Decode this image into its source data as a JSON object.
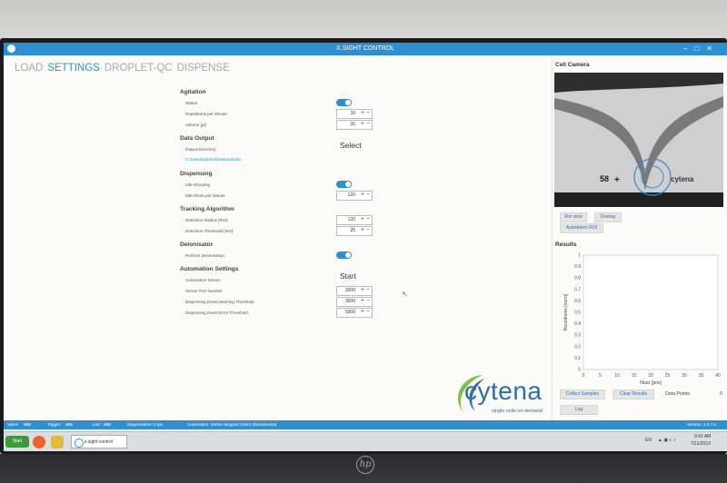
{
  "window": {
    "title": "X.SIGHT CONTROL"
  },
  "nav": {
    "tabs": [
      "LOAD",
      "SETTINGS",
      "DROPLET-QC",
      "DISPENSE"
    ],
    "active": "SETTINGS"
  },
  "agitation": {
    "title": "Agitation",
    "status_label": "Status",
    "repetitions_label": "Repetitions per Minute",
    "repetitions_value": "10",
    "volume_label": "Volume [µl]",
    "volume_value": "30"
  },
  "data_output": {
    "title": "Data Output",
    "directory_label": "Output Directory:",
    "select_label": "Select",
    "path": "C:\\Users\\admin\\Desktop\\Data"
  },
  "dispensing": {
    "title": "Dispensing",
    "idle_shooting_label": "Idle-Shooting",
    "idle_shots_label": "Idle-Shots per Minute",
    "idle_shots_value": "120"
  },
  "tracking": {
    "title": "Tracking Algorithm",
    "radius_label": "Detection Radius [RoI]:",
    "radius_value": "130",
    "threshold_label": "Detection Threshold [RoI]:",
    "threshold_value": "25"
  },
  "deionisator": {
    "title": "Deionisator",
    "perform_label": "Perform Deionisation"
  },
  "automation": {
    "title": "Automation Settings",
    "server_label": "Automation Server:",
    "start_label": "Start",
    "port_label": "Server Port Number",
    "port_value": "3000",
    "warning_label": "Dispensing Event Warning Threshold",
    "warning_value": "3000",
    "error_label": "Dispensing Event Error Threshold",
    "error_value": "5000"
  },
  "right_panel": {
    "camera_title": "Cell Camera",
    "camera_overlay_text": "cytena",
    "camera_number": "58",
    "roi_view": "RoI view",
    "overlay": "Overlay",
    "autodetect": "Autodetect ROI",
    "results_title": "Results",
    "collect_samples": "Collect Samples",
    "clear_results": "Clear Results",
    "data_points_label": "Data Points",
    "data_points_value": "0",
    "log": "Log"
  },
  "chart_data": {
    "type": "scatter",
    "xlabel": "Nozz [pos]",
    "ylabel": "Roundness [norm]",
    "xlim": [
      0,
      40
    ],
    "ylim": [
      0,
      1
    ],
    "x_ticks": [
      "0",
      "5",
      "10",
      "15",
      "20",
      "25",
      "30",
      "35",
      "40"
    ],
    "y_ticks": [
      "0",
      "0.1",
      "0.2",
      "0.3",
      "0.4",
      "0.5",
      "0.6",
      "0.7",
      "0.8",
      "0.9",
      "1"
    ],
    "series": []
  },
  "logo": {
    "word": "cytena",
    "tagline": "single cells on demand"
  },
  "statusbar": {
    "valve": "Valve:",
    "trigger": "Trigger:",
    "led": "Led:",
    "dispensation": "Dispensation: 0 ips",
    "automation": "Automation:   Server stopped  Client disconnected",
    "version": "Version: 1.0.7.0"
  },
  "taskbar": {
    "start": "Start",
    "task": "x.sight control",
    "lang": "EN",
    "time": "9:41 AM",
    "date": "7/11/2019"
  },
  "colors": {
    "accent": "#2f8fd0",
    "brand": "#2f6da8"
  }
}
